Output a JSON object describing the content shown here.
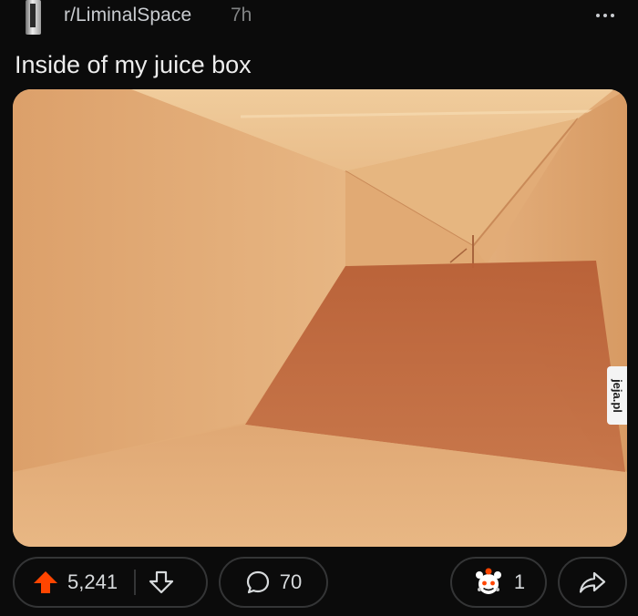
{
  "post": {
    "subreddit": "r/LiminalSpace",
    "age": "7h",
    "title": "Inside of my juice box"
  },
  "media": {
    "description_icon": "photo",
    "watermark": "jeja.pl"
  },
  "actions": {
    "score": "5,241",
    "comments": "70",
    "awards": "1"
  },
  "icons": {
    "subreddit_avatar": "subreddit-avatar",
    "overflow": "more-horizontal-icon",
    "upvote": "arrow-up-icon",
    "downvote": "arrow-down-icon",
    "comment": "speech-bubble-icon",
    "award": "award-icon",
    "share": "share-arrow-icon"
  },
  "colors": {
    "background": "#0b0b0b",
    "upvote_active": "#ff4500",
    "pill_border": "#343536",
    "text_primary": "#ededed",
    "text_muted": "#818384"
  }
}
